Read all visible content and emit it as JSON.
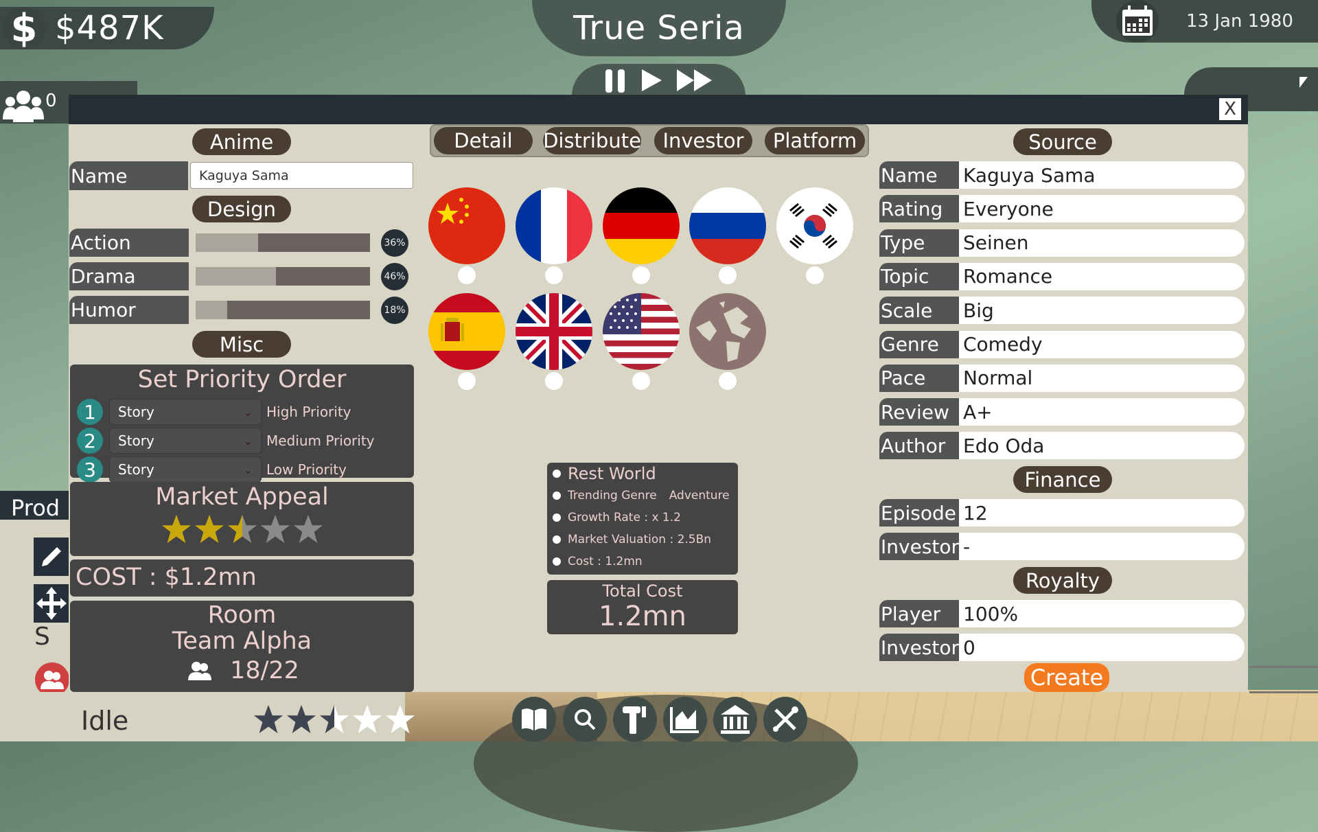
{
  "hud": {
    "money": "$487K",
    "money_icon": "dollar-icon",
    "team_count": "0",
    "studio_name": "True Seria",
    "date": "13 Jan 1980"
  },
  "sidebar": {
    "prod_label": "Prod",
    "s_label": "S",
    "status": "Idle",
    "rating_stars": 2.5
  },
  "modal": {
    "close_label": "X",
    "left": {
      "anime_header": "Anime",
      "name_label": "Name",
      "name_value": "Kaguya Sama",
      "design_header": "Design",
      "design": [
        {
          "label": "Action",
          "percent": 36,
          "pct_text": "36%"
        },
        {
          "label": "Drama",
          "percent": 46,
          "pct_text": "46%"
        },
        {
          "label": "Humor",
          "percent": 18,
          "pct_text": "18%"
        }
      ],
      "misc_header": "Misc",
      "priority_title": "Set Priority Order",
      "priorities": [
        {
          "num": "1",
          "value": "Story",
          "level": "High Priority"
        },
        {
          "num": "2",
          "value": "Story",
          "level": "Medium Priority"
        },
        {
          "num": "3",
          "value": "Story",
          "level": "Low Priority"
        }
      ],
      "market_title": "Market Appeal",
      "market_stars": 2.5,
      "cost": "COST : $1.2mn",
      "room_title": "Room",
      "room_team": "Team Alpha",
      "room_capacity": "18/22"
    },
    "tabs": [
      "Detail",
      "Distribute",
      "Investor",
      "Platform"
    ],
    "regions": [
      {
        "name": "China",
        "icon": "china-flag-icon"
      },
      {
        "name": "France",
        "icon": "france-flag-icon"
      },
      {
        "name": "Germany",
        "icon": "germany-flag-icon"
      },
      {
        "name": "Russia",
        "icon": "russia-flag-icon"
      },
      {
        "name": "South Korea",
        "icon": "south-korea-flag-icon"
      },
      {
        "name": "Spain",
        "icon": "spain-flag-icon"
      },
      {
        "name": "United Kingdom",
        "icon": "uk-flag-icon"
      },
      {
        "name": "United States",
        "icon": "us-flag-icon"
      },
      {
        "name": "Rest World",
        "icon": "globe-icon"
      }
    ],
    "market_info": {
      "region": "Rest World",
      "trending_label": "Trending Genre",
      "trending_value": "Adventure",
      "growth": "Growth Rate :   x 1.2",
      "valuation": "Market Valuation : 2.5Bn",
      "cost": "Cost :   1.2mn",
      "total_label": "Total Cost",
      "total_value": "1.2mn"
    },
    "right": {
      "source_header": "Source",
      "source": [
        {
          "label": "Name",
          "value": "Kaguya Sama"
        },
        {
          "label": "Rating",
          "value": "Everyone"
        },
        {
          "label": "Type",
          "value": "Seinen"
        },
        {
          "label": "Topic",
          "value": "Romance"
        },
        {
          "label": "Scale",
          "value": "Big"
        },
        {
          "label": "Genre",
          "value": "Comedy"
        },
        {
          "label": "Pace",
          "value": "Normal"
        },
        {
          "label": "Review",
          "value": "A+"
        },
        {
          "label": "Author",
          "value": "Edo Oda"
        }
      ],
      "finance_header": "Finance",
      "finance": [
        {
          "label": "Episode",
          "value": "12"
        },
        {
          "label": "Investor",
          "value": "-"
        }
      ],
      "royalty_header": "Royalty",
      "royalty": [
        {
          "label": "Player",
          "value": "100%"
        },
        {
          "label": "Investor",
          "value": "0"
        }
      ],
      "create_label": "Create"
    }
  },
  "bottom_nav": [
    {
      "icon": "book-icon"
    },
    {
      "icon": "search-icon"
    },
    {
      "icon": "hammer-icon"
    },
    {
      "icon": "chart-icon"
    },
    {
      "icon": "bank-icon"
    },
    {
      "icon": "tools-icon"
    }
  ],
  "colors": {
    "accent_orange": "#f47a20",
    "star_gold": "#c9a80e",
    "priority_teal": "#2a8b86",
    "pill_brown": "#4a3d32"
  }
}
